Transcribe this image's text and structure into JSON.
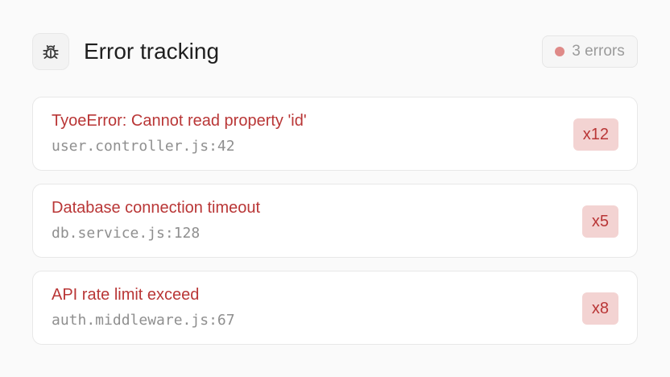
{
  "header": {
    "icon": "bug-icon",
    "title": "Error tracking",
    "error_count_label": "3 errors"
  },
  "errors": [
    {
      "message": "TyoeError: Cannot read property 'id'",
      "location": "user.controller.js:42",
      "count": "x12"
    },
    {
      "message": "Database connection timeout",
      "location": "db.service.js:128",
      "count": "x5"
    },
    {
      "message": "API rate limit exceed",
      "location": "auth.middleware.js:67",
      "count": "x8"
    }
  ],
  "colors": {
    "error_text": "#b93636",
    "count_badge_bg": "#f3d3d2",
    "status_dot": "#df8a88",
    "page_bg": "#fafafa",
    "card_bg": "#ffffff"
  }
}
